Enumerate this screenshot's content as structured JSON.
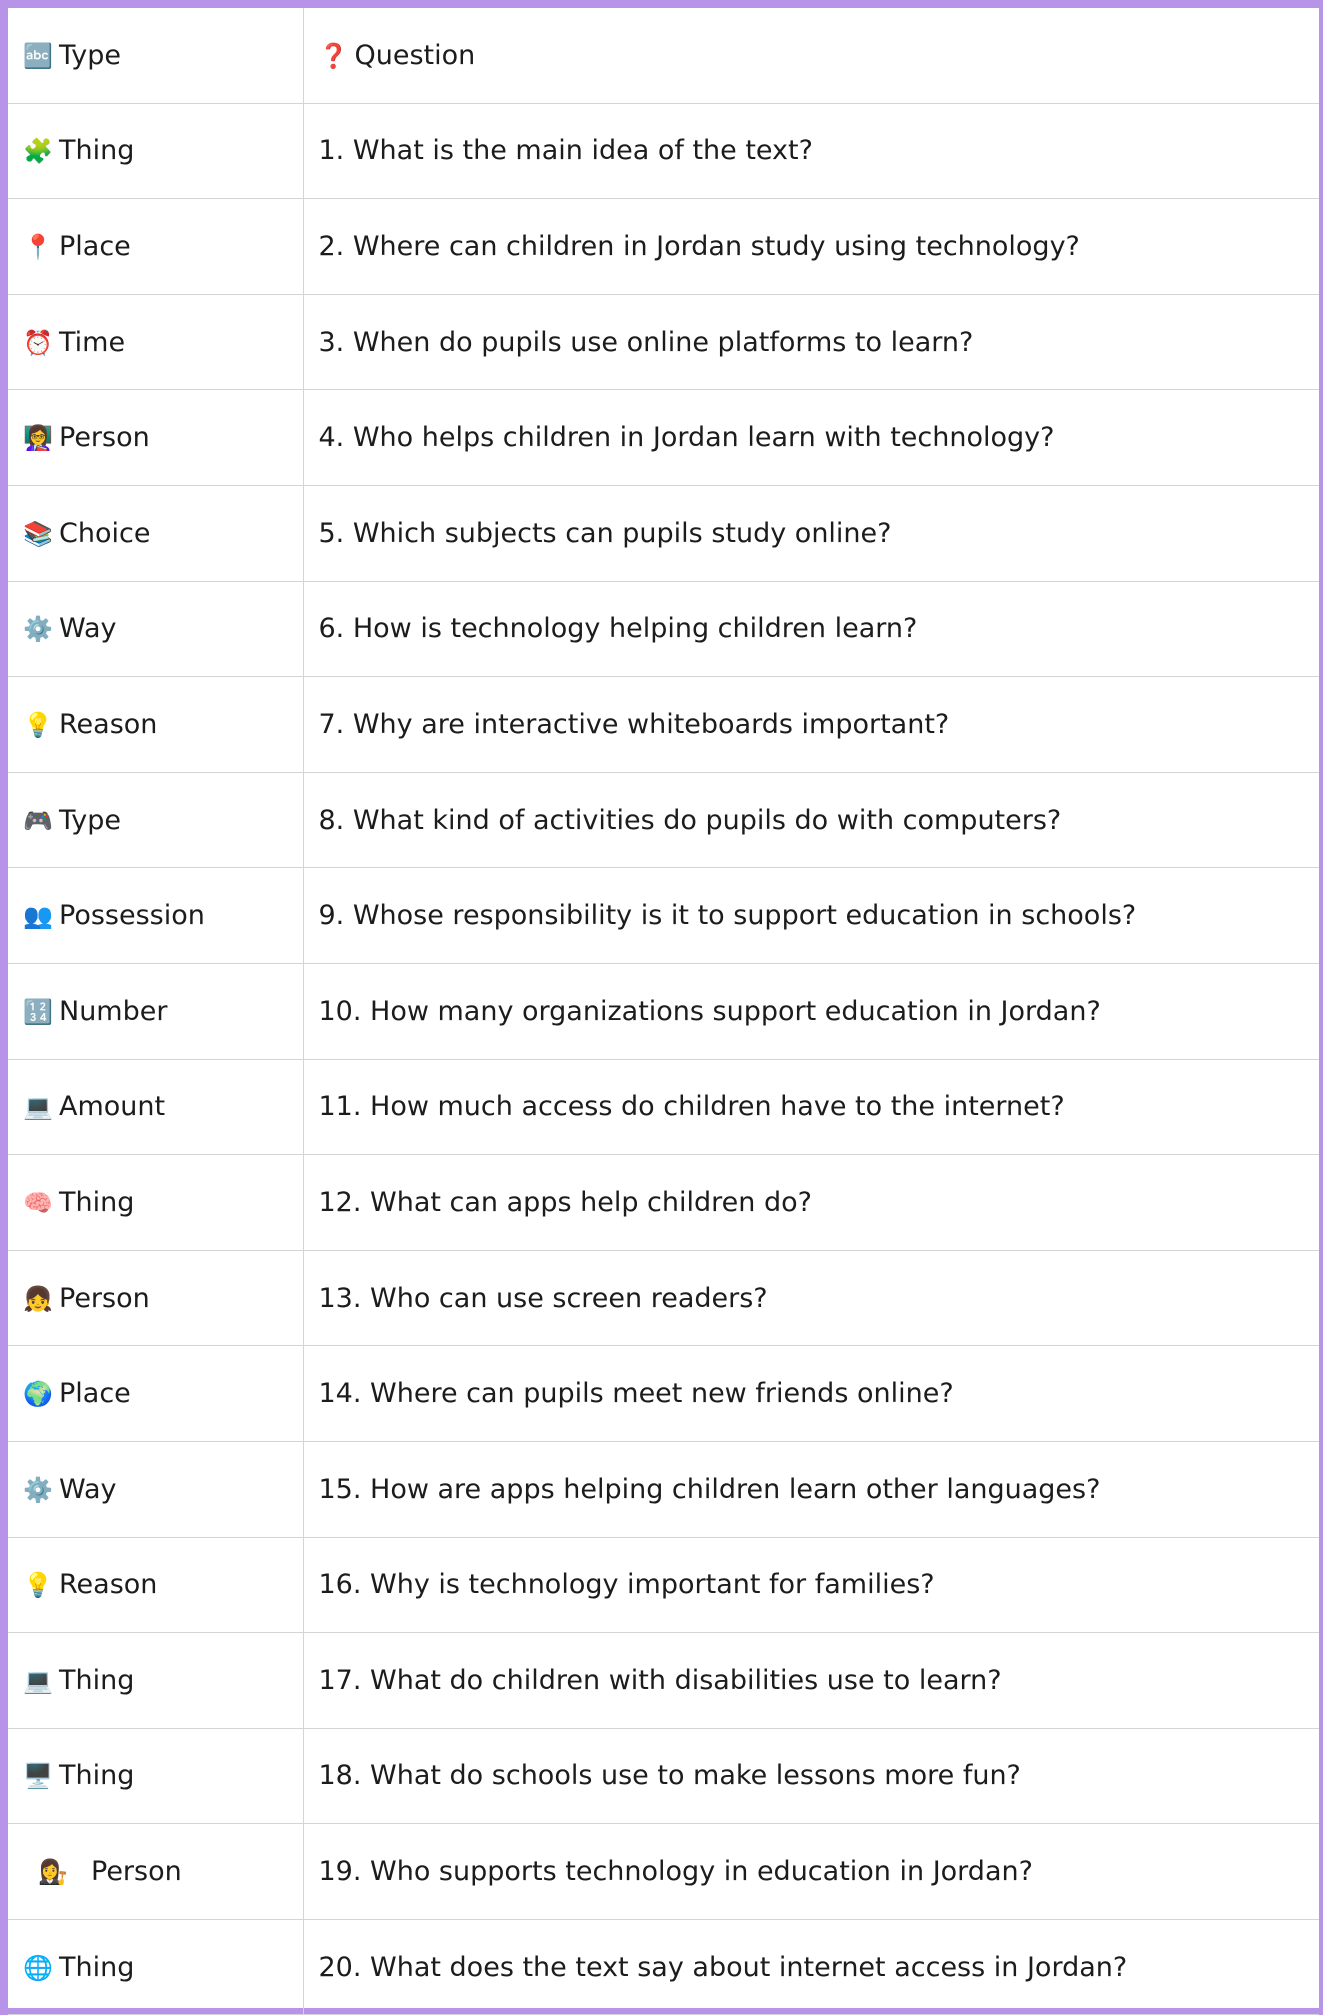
{
  "header": {
    "type_icon": "🔤",
    "type_label": "Type",
    "question_icon": "❓",
    "question_label": "Question"
  },
  "colors": {
    "border_accent": "#b794e8",
    "grid_line": "#d4d4d4",
    "question_mark": "#d0021b"
  },
  "rows": [
    {
      "icon": "🧩",
      "icon_name": "puzzle-icon",
      "type": "Thing",
      "question": "1. What is the main idea of the text?"
    },
    {
      "icon": "📍",
      "icon_name": "pin-icon",
      "type": "Place",
      "question": "2. Where can children in Jordan study using technology?"
    },
    {
      "icon": "⏰",
      "icon_name": "alarm-clock-icon",
      "type": "Time",
      "question": "3. When do pupils use online platforms to learn?"
    },
    {
      "icon": "👩‍🏫",
      "icon_name": "teacher-icon",
      "type": "Person",
      "question": "4. Who helps children in Jordan learn with technology?"
    },
    {
      "icon": "📚",
      "icon_name": "books-icon",
      "type": "Choice",
      "question": "5. Which subjects can pupils study online?"
    },
    {
      "icon": "⚙️",
      "icon_name": "gear-icon",
      "type": "Way",
      "question": "6. How is technology helping children learn?"
    },
    {
      "icon": "💡",
      "icon_name": "lightbulb-icon",
      "type": "Reason",
      "question": "7. Why are interactive whiteboards important?"
    },
    {
      "icon": "🎮",
      "icon_name": "game-controller-icon",
      "type": "Type",
      "question": "8. What kind of activities do pupils do with computers?"
    },
    {
      "icon": "👥",
      "icon_name": "people-icon",
      "type": "Possession",
      "question": "9. Whose responsibility is it to support education in schools?"
    },
    {
      "icon": "🔢",
      "icon_name": "numbers-icon",
      "type": "Number",
      "question": "10. How many organizations support education in Jordan?"
    },
    {
      "icon": "💻",
      "icon_name": "laptop-icon",
      "type": "Amount",
      "question": "11. How much access do children have to the internet?"
    },
    {
      "icon": "🧠",
      "icon_name": "brain-icon",
      "type": "Thing",
      "question": "12. What can apps help children do?"
    },
    {
      "icon": "👧",
      "icon_name": "child-icon",
      "type": "Person",
      "question": "13. Who can use screen readers?"
    },
    {
      "icon": "🌍",
      "icon_name": "globe-icon",
      "type": "Place",
      "question": "14. Where can pupils meet new friends online?"
    },
    {
      "icon": "⚙️",
      "icon_name": "gear-icon",
      "type": "Way",
      "question": "15. How are apps helping children learn other languages?"
    },
    {
      "icon": "💡",
      "icon_name": "lightbulb-icon",
      "type": "Reason",
      "question": "16. Why is technology important for families?"
    },
    {
      "icon": "💻",
      "icon_name": "laptop-icon",
      "type": "Thing",
      "question": "17. What do children with disabilities use to learn?"
    },
    {
      "icon": "🖥️",
      "icon_name": "desktop-computer-icon",
      "type": "Thing",
      "question": "18. What do schools use to make lessons more fun?"
    },
    {
      "icon": "👩‍⚖️",
      "icon_name": "judge-icon",
      "type": "Person",
      "question": "19. Who supports technology in education in Jordan?"
    },
    {
      "icon": "🌐",
      "icon_name": "globe-meridians-icon",
      "type": "Thing",
      "question": "20. What does the text say about internet access in Jordan?"
    }
  ]
}
